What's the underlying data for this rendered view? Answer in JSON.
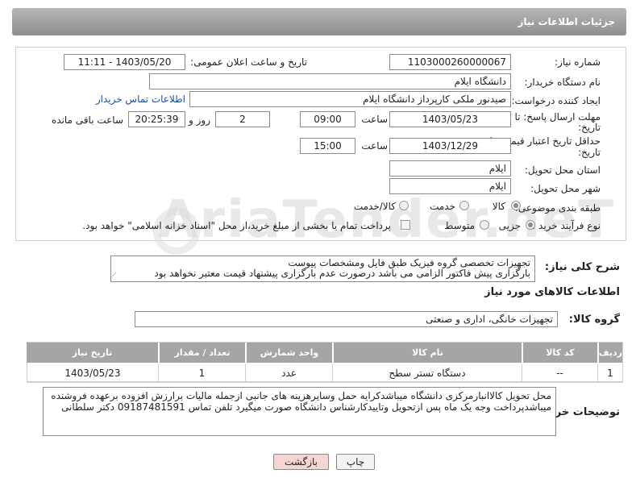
{
  "header": {
    "title": "جزئیات اطلاعات نیاز"
  },
  "fields": {
    "need_number_label": "شماره نیاز:",
    "need_number": "1103000260000067",
    "announce_label": "تاریخ و ساعت اعلان عمومی:",
    "announce_value": "1403/05/20 - 11:11",
    "buyer_label": "نام دستگاه خریدار:",
    "buyer_value": "دانشگاه ایلام",
    "creator_label": "ایجاد کننده درخواست:",
    "creator_value": "صیدنور ملکی کارپرداز دانشگاه ایلام",
    "contact_link": "اطلاعات تماس خریدار",
    "deadline_label_1": "مهلت ارسال پاسخ: تا",
    "deadline_label_2": "تاریخ:",
    "deadline_date": "1403/05/23",
    "time_word": "ساعت",
    "deadline_time": "09:00",
    "days_value": "2",
    "days_word": "روز و",
    "remaining_time": "20:25:39",
    "remaining_word": "ساعت باقی مانده",
    "validity_label_1": "حداقل تاریخ اعتبار قیمت: تا",
    "validity_label_2": "تاریخ:",
    "validity_date": "1403/12/29",
    "validity_time": "15:00",
    "province_label": "استان محل تحویل:",
    "province_value": "ایلام",
    "city_label": "شهر محل تحویل:",
    "city_value": "ایلام",
    "category_label": "طبقه بندی موضوعی:",
    "category_options": [
      "کالا",
      "خدمت",
      "کالا/خدمت"
    ],
    "process_label": "نوع فرآیند خرید :",
    "process_options": [
      "جزیی",
      "متوسط"
    ],
    "payment_text": "پرداخت تمام یا بخشی از مبلغ خرید،از محل \"اسناد خزانه اسلامی\" خواهد بود."
  },
  "summary": {
    "label": "شرح کلی نیاز:",
    "line1": "تجهیزات تخصصی گروه فیزیک طبق فایل ومشخصات پیوست",
    "line2": "بارگزاری پیش فاکتور الزامی می باشد درصورت عدم بارگزاری پیشنهاد قیمت معتبر نخواهد بود"
  },
  "goods": {
    "section_title": "اطلاعات کالاهای مورد نیاز",
    "group_label": "گروه کالا:",
    "group_value": "تجهیزات خانگی، اداری و صنعتی",
    "columns": [
      "ردیف",
      "کد کالا",
      "نام کالا",
      "واحد شمارش",
      "تعداد / مقدار",
      "تاریخ نیاز"
    ],
    "rows": [
      {
        "row": "1",
        "code": "--",
        "name": "دستگاه تستر سطح",
        "unit": "عدد",
        "qty": "1",
        "date": "1403/05/23"
      }
    ]
  },
  "buyer_notes": {
    "label": "توضیحات خریدار:",
    "text": "محل تحویل کالاانبارمرکزی دانشگاه میباشدکرایه حمل وسایرهزینه های جانبی ازجمله مالیات برارزش افزوده برعهده فروشنده میباشدپرداخت وجه یک ماه پس ازتحویل وتاییدکارشناس دانشگاه صورت میگیرد تلفن تماس 09187481591 دکتر سلطانی"
  },
  "buttons": {
    "print": "چاپ",
    "back": "بازگشت"
  },
  "watermark": "AriaTender.neT",
  "colors": {
    "title_bar": "#9f9f9f",
    "back_button": "#f6d5d5",
    "link": "#1a4fa8"
  }
}
